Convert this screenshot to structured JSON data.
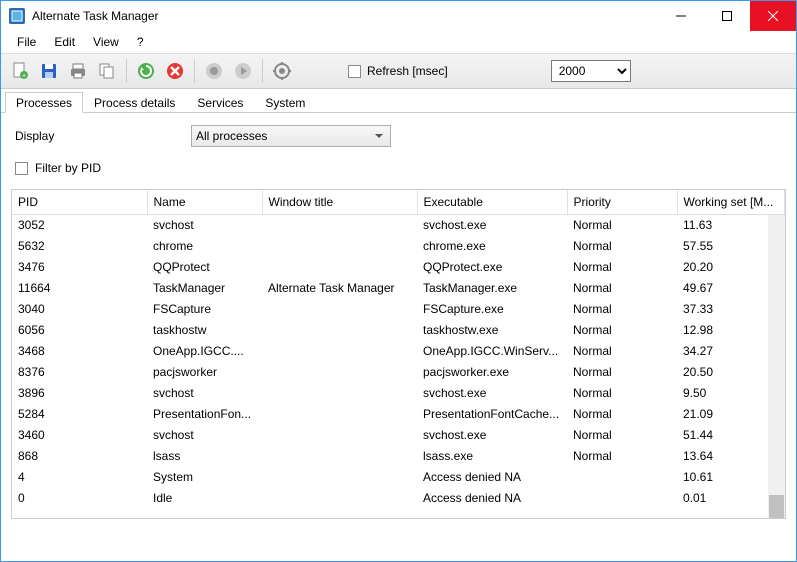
{
  "window": {
    "title": "Alternate Task Manager"
  },
  "menu": {
    "file": "File",
    "edit": "Edit",
    "view": "View",
    "help": "?"
  },
  "toolbar": {
    "refresh_label": "Refresh [msec]",
    "refresh_value": "2000"
  },
  "tabs": {
    "processes": "Processes",
    "process_details": "Process details",
    "services": "Services",
    "system": "System"
  },
  "filters": {
    "display_label": "Display",
    "display_value": "All processes",
    "filter_pid_label": "Filter by PID"
  },
  "columns": {
    "pid": "PID",
    "name": "Name",
    "window_title": "Window title",
    "executable": "Executable",
    "priority": "Priority",
    "working_set": "Working set [M..."
  },
  "rows": [
    {
      "pid": "3052",
      "name": "svchost",
      "wt": "",
      "exe": "svchost.exe",
      "pri": "Normal",
      "ws": "11.63"
    },
    {
      "pid": "5632",
      "name": "chrome",
      "wt": "",
      "exe": "chrome.exe",
      "pri": "Normal",
      "ws": "57.55"
    },
    {
      "pid": "3476",
      "name": "QQProtect",
      "wt": "",
      "exe": "QQProtect.exe",
      "pri": "Normal",
      "ws": "20.20"
    },
    {
      "pid": "11664",
      "name": "TaskManager",
      "wt": "Alternate Task Manager",
      "exe": "TaskManager.exe",
      "pri": "Normal",
      "ws": "49.67"
    },
    {
      "pid": "3040",
      "name": "FSCapture",
      "wt": "",
      "exe": "FSCapture.exe",
      "pri": "Normal",
      "ws": "37.33"
    },
    {
      "pid": "6056",
      "name": "taskhostw",
      "wt": "",
      "exe": "taskhostw.exe",
      "pri": "Normal",
      "ws": "12.98"
    },
    {
      "pid": "3468",
      "name": "OneApp.IGCC....",
      "wt": "",
      "exe": "OneApp.IGCC.WinServ...",
      "pri": "Normal",
      "ws": "34.27"
    },
    {
      "pid": "8376",
      "name": "pacjsworker",
      "wt": "",
      "exe": "pacjsworker.exe",
      "pri": "Normal",
      "ws": "20.50"
    },
    {
      "pid": "3896",
      "name": "svchost",
      "wt": "",
      "exe": "svchost.exe",
      "pri": "Normal",
      "ws": "9.50"
    },
    {
      "pid": "5284",
      "name": "PresentationFon...",
      "wt": "",
      "exe": "PresentationFontCache...",
      "pri": "Normal",
      "ws": "21.09"
    },
    {
      "pid": "3460",
      "name": "svchost",
      "wt": "",
      "exe": "svchost.exe",
      "pri": "Normal",
      "ws": "51.44"
    },
    {
      "pid": "868",
      "name": "lsass",
      "wt": "",
      "exe": "lsass.exe",
      "pri": "Normal",
      "ws": "13.64"
    },
    {
      "pid": "4",
      "name": "System",
      "wt": "",
      "exe": "Access denied NA",
      "pri": "",
      "ws": "10.61"
    },
    {
      "pid": "0",
      "name": "Idle",
      "wt": "",
      "exe": "Access denied NA",
      "pri": "",
      "ws": "0.01"
    }
  ]
}
